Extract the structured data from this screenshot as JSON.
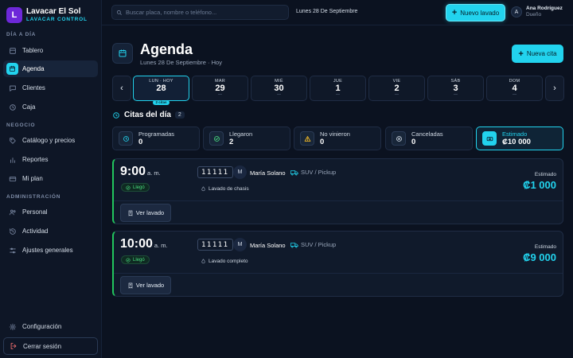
{
  "brand": {
    "initial": "L",
    "name": "Lavacar El Sol",
    "subtitle": "LAVACAR CONTROL"
  },
  "sidebar": {
    "sections": [
      "DÍA A DÍA",
      "NEGOCIO",
      "ADMINISTRACIÓN"
    ],
    "items": [
      {
        "label": "Tablero",
        "icon": "dashboard-icon"
      },
      {
        "label": "Agenda",
        "icon": "calendar-icon",
        "active": true
      },
      {
        "label": "Clientes",
        "icon": "chat-icon"
      },
      {
        "label": "Caja",
        "icon": "clock-icon"
      },
      {
        "label": "Catálogo y precios",
        "icon": "tag-icon"
      },
      {
        "label": "Reportes",
        "icon": "chart-icon"
      },
      {
        "label": "Mi plan",
        "icon": "card-icon"
      },
      {
        "label": "Personal",
        "icon": "users-icon"
      },
      {
        "label": "Actividad",
        "icon": "history-icon"
      },
      {
        "label": "Ajustes generales",
        "icon": "sliders-icon"
      }
    ],
    "settings_label": "Configuración",
    "logout_label": "Cerrar sesión"
  },
  "topbar": {
    "search_placeholder": "Buscar placa, nombre o teléfono...",
    "date": "Lunes 28 De Septiembre",
    "new_wash_label": "Nuevo lavado",
    "user": {
      "initial": "A",
      "name": "Ana Rodríguez",
      "role": "Dueño"
    }
  },
  "header": {
    "title": "Agenda",
    "subtitle": "Lunes 28 De Septiembre · Hoy",
    "new_appointment_label": "Nueva cita"
  },
  "date_strip": {
    "days": [
      {
        "name": "LUN · HOY",
        "num": "28",
        "badge": "2 citas",
        "active": true
      },
      {
        "name": "MAR",
        "num": "29",
        "dot": "—"
      },
      {
        "name": "MIÉ",
        "num": "30",
        "dot": "—"
      },
      {
        "name": "JUE",
        "num": "1",
        "dot": "—"
      },
      {
        "name": "VIE",
        "num": "2",
        "dot": "—"
      },
      {
        "name": "SÁB",
        "num": "3",
        "dot": "—"
      },
      {
        "name": "DOM",
        "num": "4",
        "dot": "—"
      }
    ]
  },
  "citas": {
    "title": "Citas del día",
    "count": "2",
    "stats": [
      {
        "label": "Programadas",
        "value": "0",
        "icon": "clock-icon",
        "color": "#22d3ee"
      },
      {
        "label": "Llegaron",
        "value": "2",
        "icon": "check-circle-icon",
        "color": "#4ade80"
      },
      {
        "label": "No vinieron",
        "value": "0",
        "icon": "warning-icon",
        "color": "#fbbf24"
      },
      {
        "label": "Canceladas",
        "value": "0",
        "icon": "x-circle-icon",
        "color": "#cfd8e3"
      },
      {
        "label": "Estimado",
        "value": "₡10 000",
        "icon": "money-icon",
        "color": "#0b1220",
        "highlight": true
      }
    ],
    "appointments": [
      {
        "time": "9:00",
        "ampm": "a. m.",
        "status": "Llegó",
        "plate": "11111",
        "client_initial": "M",
        "client_name": "María Solano",
        "vehicle": "SUV / Pickup",
        "service": "Lavado de chasis",
        "estimate_label": "Estimado",
        "estimate": "₡1 000",
        "action": "Ver lavado"
      },
      {
        "time": "10:00",
        "ampm": "a. m.",
        "status": "Llegó",
        "plate": "11111",
        "client_initial": "M",
        "client_name": "María Solano",
        "vehicle": "SUV / Pickup",
        "service": "Lavado completo",
        "estimate_label": "Estimado",
        "estimate": "₡9 000",
        "action": "Ver lavado"
      }
    ]
  }
}
